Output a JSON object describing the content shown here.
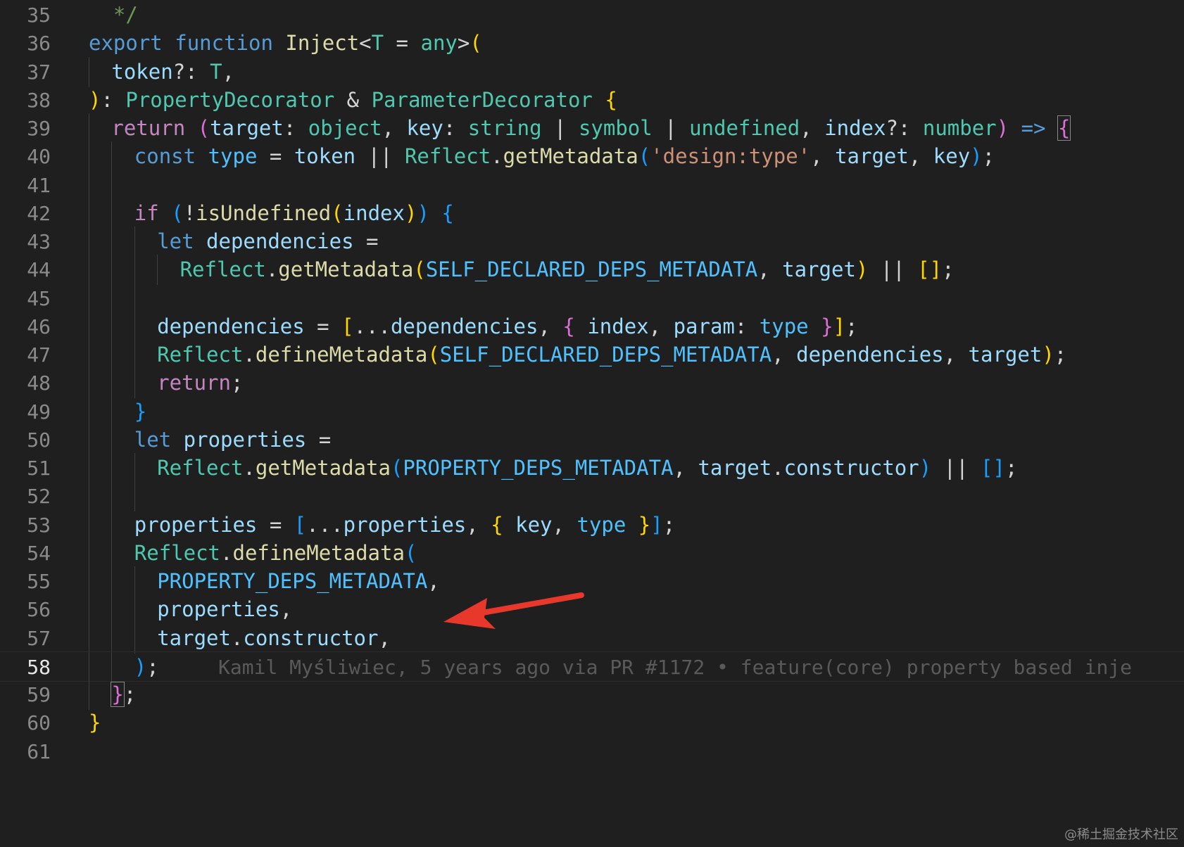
{
  "colors": {
    "background": "#1f1f1f",
    "keyword_blue": "#569cd6",
    "control_purple": "#c586c0",
    "function_yellow": "#dcdcaa",
    "type_teal": "#4ec9b0",
    "variable_light": "#9cdcfe",
    "string_orange": "#ce9178",
    "comment_green": "#6a9955",
    "bracket_gold": "#ffd700",
    "bracket_pink": "#da70d6",
    "bracket_blue": "#179fff",
    "const_blue": "#4fc1ff",
    "arrow_red": "#e8382c"
  },
  "editor": {
    "active_line": 58,
    "blame": "Kamil Myśliwiec, 5 years ago via PR #1172 • feature(core) property based inje",
    "lines": [
      {
        "n": 35,
        "indent": 0,
        "tokens": [
          [
            "  */",
            "comment"
          ]
        ]
      },
      {
        "n": 36,
        "indent": 0,
        "tokens": [
          [
            "export",
            "kw"
          ],
          [
            " ",
            "p"
          ],
          [
            "function",
            "kw"
          ],
          [
            " ",
            "p"
          ],
          [
            "Inject",
            "fn"
          ],
          [
            "<",
            "p"
          ],
          [
            "T",
            "type"
          ],
          [
            " = ",
            "p"
          ],
          [
            "any",
            "type"
          ],
          [
            ">",
            "p"
          ],
          [
            "(",
            "b1"
          ]
        ]
      },
      {
        "n": 37,
        "indent": 1,
        "tokens": [
          [
            "token",
            "var"
          ],
          [
            "?: ",
            "p"
          ],
          [
            "T",
            "type"
          ],
          [
            ",",
            "p"
          ]
        ]
      },
      {
        "n": 38,
        "indent": 0,
        "tokens": [
          [
            ")",
            "b1"
          ],
          [
            ": ",
            "p"
          ],
          [
            "PropertyDecorator",
            "type"
          ],
          [
            " & ",
            "p"
          ],
          [
            "ParameterDecorator",
            "type"
          ],
          [
            " ",
            "p"
          ],
          [
            "{",
            "b1"
          ]
        ]
      },
      {
        "n": 39,
        "indent": 1,
        "tokens": [
          [
            "return",
            "ctl"
          ],
          [
            " ",
            "p"
          ],
          [
            "(",
            "b2"
          ],
          [
            "target",
            "var"
          ],
          [
            ": ",
            "p"
          ],
          [
            "object",
            "type"
          ],
          [
            ", ",
            "p"
          ],
          [
            "key",
            "var"
          ],
          [
            ": ",
            "p"
          ],
          [
            "string",
            "type"
          ],
          [
            " | ",
            "p"
          ],
          [
            "symbol",
            "type"
          ],
          [
            " | ",
            "p"
          ],
          [
            "undefined",
            "type"
          ],
          [
            ", ",
            "p"
          ],
          [
            "index",
            "var"
          ],
          [
            "?: ",
            "p"
          ],
          [
            "number",
            "type"
          ],
          [
            ")",
            "b2"
          ],
          [
            " ",
            "p"
          ],
          [
            "=>",
            "kw"
          ],
          [
            " ",
            "p"
          ],
          [
            "{",
            "b2box"
          ]
        ]
      },
      {
        "n": 40,
        "indent": 2,
        "tokens": [
          [
            "const",
            "kw"
          ],
          [
            " ",
            "p"
          ],
          [
            "type",
            "const"
          ],
          [
            " = ",
            "p"
          ],
          [
            "token",
            "var"
          ],
          [
            " || ",
            "p"
          ],
          [
            "Reflect",
            "type"
          ],
          [
            ".",
            "p"
          ],
          [
            "getMetadata",
            "fn"
          ],
          [
            "(",
            "b3"
          ],
          [
            "'design:type'",
            "str"
          ],
          [
            ", ",
            "p"
          ],
          [
            "target",
            "var"
          ],
          [
            ", ",
            "p"
          ],
          [
            "key",
            "var"
          ],
          [
            ")",
            "b3"
          ],
          [
            ";",
            "p"
          ]
        ]
      },
      {
        "n": 41,
        "indent": 2,
        "tokens": []
      },
      {
        "n": 42,
        "indent": 2,
        "tokens": [
          [
            "if",
            "ctl"
          ],
          [
            " ",
            "p"
          ],
          [
            "(",
            "b3"
          ],
          [
            "!",
            "p"
          ],
          [
            "isUndefined",
            "fn"
          ],
          [
            "(",
            "b1"
          ],
          [
            "index",
            "var"
          ],
          [
            ")",
            "b1"
          ],
          [
            ")",
            "b3"
          ],
          [
            " ",
            "p"
          ],
          [
            "{",
            "b3"
          ]
        ]
      },
      {
        "n": 43,
        "indent": 3,
        "tokens": [
          [
            "let",
            "kw"
          ],
          [
            " ",
            "p"
          ],
          [
            "dependencies",
            "var"
          ],
          [
            " =",
            "p"
          ]
        ]
      },
      {
        "n": 44,
        "indent": 4,
        "tokens": [
          [
            "Reflect",
            "type"
          ],
          [
            ".",
            "p"
          ],
          [
            "getMetadata",
            "fn"
          ],
          [
            "(",
            "b1"
          ],
          [
            "SELF_DECLARED_DEPS_METADATA",
            "const"
          ],
          [
            ", ",
            "p"
          ],
          [
            "target",
            "var"
          ],
          [
            ")",
            "b1"
          ],
          [
            " || ",
            "p"
          ],
          [
            "[]",
            "b1"
          ],
          [
            ";",
            "p"
          ]
        ]
      },
      {
        "n": 45,
        "indent": 3,
        "tokens": []
      },
      {
        "n": 46,
        "indent": 3,
        "tokens": [
          [
            "dependencies",
            "var"
          ],
          [
            " = ",
            "p"
          ],
          [
            "[",
            "b1"
          ],
          [
            "...",
            "p"
          ],
          [
            "dependencies",
            "var"
          ],
          [
            ", ",
            "p"
          ],
          [
            "{",
            "b2"
          ],
          [
            " ",
            "p"
          ],
          [
            "index",
            "var"
          ],
          [
            ", ",
            "p"
          ],
          [
            "param",
            "var"
          ],
          [
            ": ",
            "p"
          ],
          [
            "type",
            "const"
          ],
          [
            " ",
            "p"
          ],
          [
            "}",
            "b2"
          ],
          [
            "]",
            "b1"
          ],
          [
            ";",
            "p"
          ]
        ]
      },
      {
        "n": 47,
        "indent": 3,
        "tokens": [
          [
            "Reflect",
            "type"
          ],
          [
            ".",
            "p"
          ],
          [
            "defineMetadata",
            "fn"
          ],
          [
            "(",
            "b1"
          ],
          [
            "SELF_DECLARED_DEPS_METADATA",
            "const"
          ],
          [
            ", ",
            "p"
          ],
          [
            "dependencies",
            "var"
          ],
          [
            ", ",
            "p"
          ],
          [
            "target",
            "var"
          ],
          [
            ")",
            "b1"
          ],
          [
            ";",
            "p"
          ]
        ]
      },
      {
        "n": 48,
        "indent": 3,
        "tokens": [
          [
            "return",
            "ctl"
          ],
          [
            ";",
            "p"
          ]
        ]
      },
      {
        "n": 49,
        "indent": 2,
        "tokens": [
          [
            "}",
            "b3"
          ]
        ]
      },
      {
        "n": 50,
        "indent": 2,
        "tokens": [
          [
            "let",
            "kw"
          ],
          [
            " ",
            "p"
          ],
          [
            "properties",
            "var"
          ],
          [
            " =",
            "p"
          ]
        ]
      },
      {
        "n": 51,
        "indent": 3,
        "tokens": [
          [
            "Reflect",
            "type"
          ],
          [
            ".",
            "p"
          ],
          [
            "getMetadata",
            "fn"
          ],
          [
            "(",
            "b3"
          ],
          [
            "PROPERTY_DEPS_METADATA",
            "const"
          ],
          [
            ", ",
            "p"
          ],
          [
            "target",
            "var"
          ],
          [
            ".",
            "p"
          ],
          [
            "constructor",
            "var"
          ],
          [
            ")",
            "b3"
          ],
          [
            " || ",
            "p"
          ],
          [
            "[]",
            "b3"
          ],
          [
            ";",
            "p"
          ]
        ]
      },
      {
        "n": 52,
        "indent": 3,
        "tokens": []
      },
      {
        "n": 53,
        "indent": 2,
        "tokens": [
          [
            "properties",
            "var"
          ],
          [
            " = ",
            "p"
          ],
          [
            "[",
            "b3"
          ],
          [
            "...",
            "p"
          ],
          [
            "properties",
            "var"
          ],
          [
            ", ",
            "p"
          ],
          [
            "{",
            "b1"
          ],
          [
            " ",
            "p"
          ],
          [
            "key",
            "var"
          ],
          [
            ", ",
            "p"
          ],
          [
            "type",
            "const"
          ],
          [
            " ",
            "p"
          ],
          [
            "}",
            "b1"
          ],
          [
            "]",
            "b3"
          ],
          [
            ";",
            "p"
          ]
        ]
      },
      {
        "n": 54,
        "indent": 2,
        "tokens": [
          [
            "Reflect",
            "type"
          ],
          [
            ".",
            "p"
          ],
          [
            "defineMetadata",
            "fn"
          ],
          [
            "(",
            "b3"
          ]
        ]
      },
      {
        "n": 55,
        "indent": 3,
        "tokens": [
          [
            "PROPERTY_DEPS_METADATA",
            "const"
          ],
          [
            ",",
            "p"
          ]
        ]
      },
      {
        "n": 56,
        "indent": 3,
        "tokens": [
          [
            "properties",
            "var"
          ],
          [
            ",",
            "p"
          ]
        ]
      },
      {
        "n": 57,
        "indent": 3,
        "tokens": [
          [
            "target",
            "var"
          ],
          [
            ".",
            "p"
          ],
          [
            "constructor",
            "var"
          ],
          [
            ",",
            "p"
          ]
        ]
      },
      {
        "n": 58,
        "indent": 2,
        "tokens": [
          [
            ")",
            "b3"
          ],
          [
            ";",
            "p"
          ]
        ],
        "blame": true
      },
      {
        "n": 59,
        "indent": 1,
        "tokens": [
          [
            "}",
            "b2box"
          ],
          [
            ";",
            "p"
          ]
        ]
      },
      {
        "n": 60,
        "indent": 0,
        "tokens": [
          [
            "}",
            "b1"
          ]
        ]
      },
      {
        "n": 61,
        "indent": 0,
        "tokens": []
      }
    ]
  },
  "watermark": "@稀土掘金技术社区",
  "icons": {
    "annotation_arrow": "red-arrow-icon"
  }
}
